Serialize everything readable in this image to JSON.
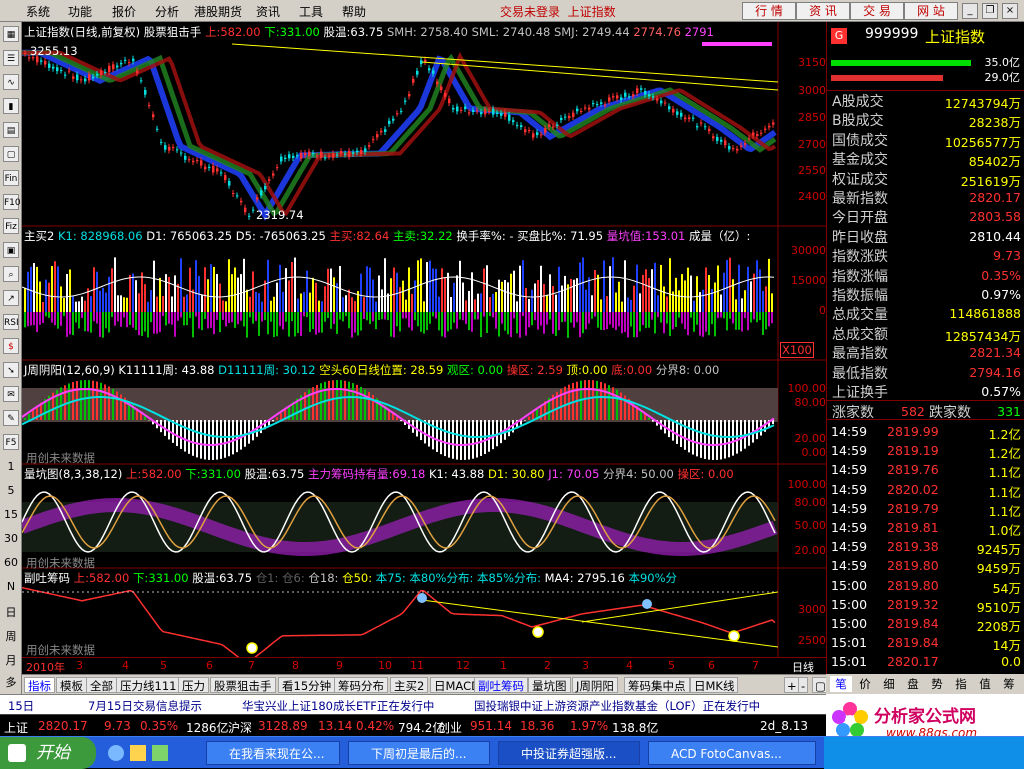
{
  "menu": {
    "items": [
      "系统",
      "功能",
      "报价",
      "分析",
      "港股期货",
      "资讯",
      "工具",
      "帮助"
    ],
    "status": "交易未登录",
    "index_name": "上证指数",
    "buttons": [
      "行 情",
      "资 讯",
      "交 易",
      "网 站"
    ]
  },
  "toolbar": {
    "icons": [
      "grid-icon",
      "list-icon",
      "chart-line-icon",
      "candle-icon",
      "table-icon",
      "doc-icon",
      "window-icon",
      "fin-icon",
      "f10-icon",
      "news-icon",
      "fiz-icon",
      "search-icon",
      "trend-icon",
      "rsi-icon",
      "dollar-icon",
      "arrow-icon",
      "pencil-icon",
      "f5-icon"
    ],
    "labels": {
      "fin": "Fin",
      "f10": "F10",
      "fiz": "Fiz",
      "rsi": "RSI",
      "f5": "F5"
    },
    "periods": [
      "1",
      "5",
      "15",
      "30",
      "60",
      "N",
      "日",
      "周",
      "月",
      "多"
    ]
  },
  "panels": {
    "main": {
      "title": "上证指数(日线,前复权) 股票狙击手",
      "up_label": "上:",
      "up_value": "582.00",
      "down_label": "下:",
      "down_value": "331.00",
      "ratio_label": "股温:",
      "ratio_value": "63.75",
      "smh": "SMH: 2758.40",
      "sml": "SML: 2740.48",
      "smj": "SMJ: 2749.44",
      "val2": "2774.76",
      "val3": "2791",
      "high_mark": "3255.13",
      "low_mark": "2319.74",
      "ticks": [
        "3150",
        "3000",
        "2850",
        "2700",
        "2550",
        "2400"
      ]
    },
    "vol": {
      "title": "主买2",
      "k1": "K1: 828968.06",
      "d1": "D1: 765063.25",
      "d5": "D5: -765063.25",
      "zm_label": "主买:",
      "zm_value": "82.64",
      "zs_label": "主卖:",
      "zs_value": "32.22",
      "hs": "换手率%: -",
      "mp": "买盘比%: 71.95",
      "lk_label": "量坑值:",
      "lk_value": "153.01",
      "unit": "成量（亿）:",
      "ticks": [
        "30000",
        "15000",
        "0"
      ],
      "scale": "X100"
    },
    "week": {
      "title": "J周阴阳(12,60,9)",
      "k": "K11111周: 43.88",
      "d": "D11111周: 30.12",
      "kt": "空头60日线位置: 28.59",
      "gq": "观区: 0.00",
      "cq": "操区: 2.59",
      "d_label": "顶:",
      "d_value": "0.00",
      "b_label": "底:",
      "b_value": "0.00",
      "fj": "分界8: 0.00",
      "ticks": [
        "100.00",
        "80.00",
        "20.00",
        "0.00"
      ],
      "watermark": "用创未来数据"
    },
    "kd": {
      "title": "量坑图(8,3,38,12)",
      "up_label": "上:",
      "up_value": "582.00",
      "down_label": "下:",
      "down_value": "331.00",
      "ratio_label": "股温:",
      "ratio_value": "63.75",
      "cm_label": "主力筹码持有量:",
      "cm_value": "69.18",
      "k1": "K1: 43.88",
      "d1": "D1: 30.80",
      "j1": "J1: 70.05",
      "fj": "分界4: 50.00",
      "cq": "操区: 0.00",
      "ticks": [
        "100.00",
        "80.00",
        "50.00",
        "20.00"
      ],
      "watermark": "用创未来数据"
    },
    "chip": {
      "title": "副吐筹码",
      "up_label": "上:",
      "up_value": "582.00",
      "down_label": "下:",
      "down_value": "331.00",
      "ratio_label": "股温:",
      "ratio_value": "63.75",
      "c1": "仓1:",
      "c6": "仓6:",
      "c18": "仓18:",
      "c50": "仓50:",
      "b75": "本75:",
      "b80": "本80%分布:",
      "b85": "本85%分布:",
      "ma4": "MA4: 2795.16",
      "b90": "本90%分",
      "ticks": [
        "3000",
        "2500"
      ],
      "watermark": "用创未来数据"
    }
  },
  "xaxis": {
    "year": "2010年",
    "months": [
      "3",
      "4",
      "5",
      "6",
      "7",
      "8",
      "9",
      "10",
      "11",
      "12",
      "1",
      "2",
      "3",
      "4",
      "5",
      "6",
      "7"
    ],
    "period": "日线"
  },
  "tabs": [
    "指标",
    "模板",
    "全部",
    "压力线111",
    "压力",
    "股票狙击手",
    "看15分钟",
    "筹码分布",
    "主买2",
    "日MACD",
    "副吐筹码",
    "量坑图",
    "J周阴阳",
    "筹码集中点",
    "日MK线"
  ],
  "right": {
    "badge": "G",
    "code": "999999",
    "name": "上证指数",
    "bar1": "35.0亿",
    "bar2": "29.0亿",
    "stats": [
      {
        "label": "A股成交",
        "value": "12743794万",
        "color": "#ffff00"
      },
      {
        "label": "B股成交",
        "value": "28238万",
        "color": "#ffff00"
      },
      {
        "label": "国债成交",
        "value": "10256577万",
        "color": "#ffff00"
      },
      {
        "label": "基金成交",
        "value": "85402万",
        "color": "#ffff00"
      },
      {
        "label": "权证成交",
        "value": "251619万",
        "color": "#ffff00"
      },
      {
        "label": "最新指数",
        "value": "2820.17",
        "color": "#ff3030"
      },
      {
        "label": "今日开盘",
        "value": "2803.58",
        "color": "#ff3030"
      },
      {
        "label": "昨日收盘",
        "value": "2810.44",
        "color": "#ffffff"
      },
      {
        "label": "指数涨跌",
        "value": "9.73",
        "color": "#ff3030"
      },
      {
        "label": "指数涨幅",
        "value": "0.35%",
        "color": "#ff3030"
      },
      {
        "label": "指数振幅",
        "value": "0.97%",
        "color": "#ffffff"
      },
      {
        "label": "总成交量",
        "value": "114861888",
        "color": "#ffff00"
      },
      {
        "label": "总成交额",
        "value": "12857434万",
        "color": "#ffff00"
      },
      {
        "label": "最高指数",
        "value": "2821.34",
        "color": "#ff3030"
      },
      {
        "label": "最低指数",
        "value": "2794.16",
        "color": "#ff3030"
      },
      {
        "label": "上证换手",
        "value": "0.57%",
        "color": "#ffffff"
      }
    ],
    "updown": {
      "up_label": "涨家数",
      "up_value": "582",
      "down_label": "跌家数",
      "down_value": "331"
    },
    "ticks": [
      {
        "time": "14:59",
        "price": "2819.99",
        "vol": "1.2亿"
      },
      {
        "time": "14:59",
        "price": "2819.19",
        "vol": "1.2亿"
      },
      {
        "time": "14:59",
        "price": "2819.76",
        "vol": "1.1亿"
      },
      {
        "time": "14:59",
        "price": "2820.02",
        "vol": "1.1亿"
      },
      {
        "time": "14:59",
        "price": "2819.79",
        "vol": "1.1亿"
      },
      {
        "time": "14:59",
        "price": "2819.81",
        "vol": "1.0亿"
      },
      {
        "time": "14:59",
        "price": "2819.38",
        "vol": "9245万"
      },
      {
        "time": "14:59",
        "price": "2819.80",
        "vol": "9459万"
      },
      {
        "time": "15:00",
        "price": "2819.80",
        "vol": "54万"
      },
      {
        "time": "15:00",
        "price": "2819.32",
        "vol": "9510万"
      },
      {
        "time": "15:00",
        "price": "2819.84",
        "vol": "2208万"
      },
      {
        "time": "15:01",
        "price": "2819.84",
        "vol": "14万"
      },
      {
        "time": "15:01",
        "price": "2820.17",
        "vol": "0.0"
      }
    ],
    "tabs": [
      "笔",
      "价",
      "细",
      "盘",
      "势",
      "指",
      "值",
      "筹"
    ]
  },
  "news": {
    "day": "15日",
    "i1": "7月15日交易信息提示",
    "i2": "华宝兴业上证180成长ETF正在发行中",
    "i3": "国投瑞银中证上游资源产业指数基金（LOF）正在发行中"
  },
  "ticker": {
    "sh_name": "上证",
    "sh_price": "2820.17",
    "sh_chg": "9.73",
    "sh_pct": "0.35%",
    "sh_amt": "1286亿",
    "sz_name": "沪深",
    "sz_price": "3128.89",
    "sz_chg": "13.14",
    "sz_pct": "0.42%",
    "sz_amt": "794.2亿",
    "cy_name": "创业",
    "cy_price": "951.14",
    "cy_chg": "18.36",
    "cy_pct": "1.97%",
    "cy_amt": "138.8亿",
    "extra": "2d_8.13"
  },
  "logo": {
    "text": "分析家公式网",
    "url": "www.88gs.com"
  },
  "taskbar": {
    "start": "开始",
    "tasks": [
      "在我看来现在公...",
      "下周初是最后的...",
      "中投证券超强版...",
      "ACD FotoCanvas..."
    ]
  },
  "colors": {
    "up": "#ff3030",
    "down": "#00e0e0",
    "grid": "#800000",
    "axis": "#d00000",
    "yellow": "#ffff00",
    "green": "#00ff00",
    "magenta": "#ff40ff"
  }
}
